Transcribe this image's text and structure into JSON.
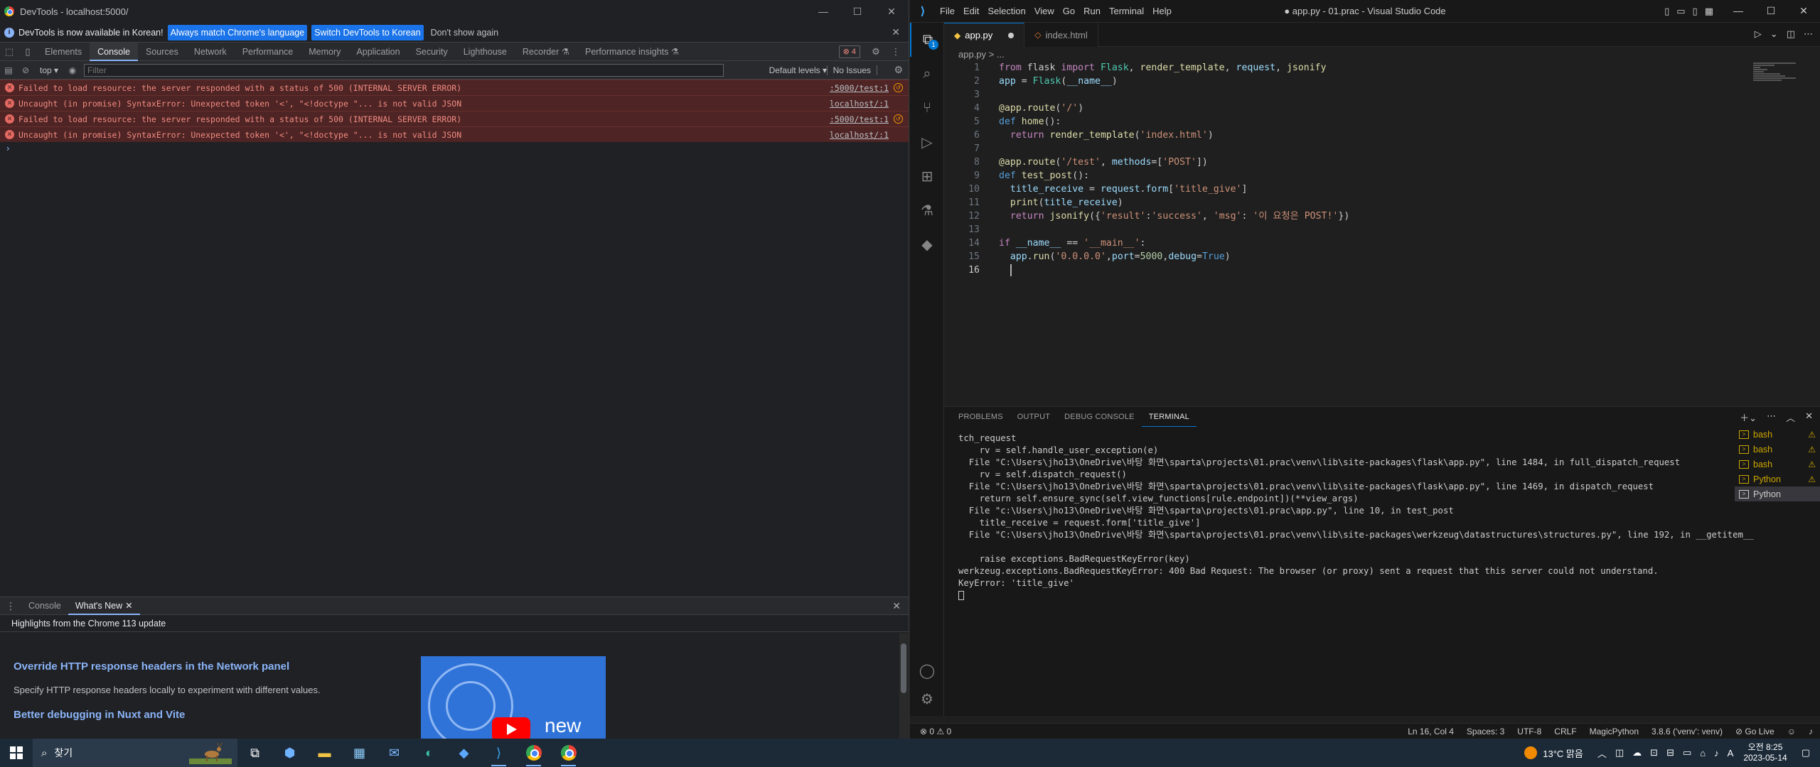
{
  "devtools": {
    "window_title": "DevTools - localhost:5000/",
    "infobar": {
      "message": "DevTools is now available in Korean!",
      "btn_match": "Always match Chrome's language",
      "btn_switch": "Switch DevTools to Korean",
      "btn_dismiss": "Don't show again"
    },
    "tabs": [
      "Elements",
      "Console",
      "Sources",
      "Network",
      "Performance",
      "Memory",
      "Application",
      "Security",
      "Lighthouse",
      "Recorder ⚗",
      "Performance insights ⚗"
    ],
    "error_badge": "4",
    "filter": {
      "context": "top",
      "placeholder": "Filter",
      "levels": "Default levels",
      "issues": "No Issues"
    },
    "logs": [
      {
        "msg": "Failed to load resource: the server responded with a status of 500 (INTERNAL SERVER ERROR)",
        "src": ":5000/test:1"
      },
      {
        "msg": "Uncaught (in promise) SyntaxError: Unexpected token '<', \"<!doctype \"... is not valid JSON",
        "src": "localhost/:1"
      },
      {
        "msg": "Failed to load resource: the server responded with a status of 500 (INTERNAL SERVER ERROR)",
        "src": ":5000/test:1"
      },
      {
        "msg": "Uncaught (in promise) SyntaxError: Unexpected token '<', \"<!doctype \"... is not valid JSON",
        "src": "localhost/:1"
      }
    ],
    "drawer": {
      "tab_console": "Console",
      "tab_whatsnew": "What's New",
      "highlights": "Highlights from the Chrome 113 update",
      "item1_title": "Override HTTP response headers in the Network panel",
      "item1_desc": "Specify HTTP response headers locally to experiment with different values.",
      "item2_title": "Better debugging in Nuxt and Vite",
      "img_text": "new"
    }
  },
  "vscode": {
    "menu": [
      "File",
      "Edit",
      "Selection",
      "View",
      "Go",
      "Run",
      "Terminal",
      "Help"
    ],
    "window_title": "● app.py - 01.prac - Visual Studio Code",
    "tabs": [
      {
        "label": "app.py"
      },
      {
        "label": "index.html"
      }
    ],
    "breadcrumb": "app.py > ...",
    "code": [
      [
        [
          "kw",
          "from"
        ],
        [
          "t",
          " flask "
        ],
        [
          "kw",
          "import"
        ],
        [
          "t",
          " "
        ],
        [
          "cls",
          "Flask"
        ],
        [
          "t",
          ", "
        ],
        [
          "fn",
          "render_template"
        ],
        [
          "t",
          ", "
        ],
        [
          "vr",
          "request"
        ],
        [
          "t",
          ", "
        ],
        [
          "fn",
          "jsonify"
        ]
      ],
      [
        [
          "vr",
          "app"
        ],
        [
          "t",
          " = "
        ],
        [
          "cls",
          "Flask"
        ],
        [
          "t",
          "("
        ],
        [
          "vr",
          "__name__"
        ],
        [
          "t",
          ")"
        ]
      ],
      [],
      [
        [
          "fn",
          "@app.route"
        ],
        [
          "t",
          "("
        ],
        [
          "st",
          "'/'"
        ],
        [
          "t",
          ")"
        ]
      ],
      [
        [
          "cn",
          "def"
        ],
        [
          "t",
          " "
        ],
        [
          "fn",
          "home"
        ],
        [
          "t",
          "():"
        ]
      ],
      [
        [
          "t",
          "  "
        ],
        [
          "kw",
          "return"
        ],
        [
          "t",
          " "
        ],
        [
          "fn",
          "render_template"
        ],
        [
          "t",
          "("
        ],
        [
          "st",
          "'index.html'"
        ],
        [
          "t",
          ")"
        ]
      ],
      [],
      [
        [
          "fn",
          "@app.route"
        ],
        [
          "t",
          "("
        ],
        [
          "st",
          "'/test'"
        ],
        [
          "t",
          ", "
        ],
        [
          "vr",
          "methods"
        ],
        [
          "t",
          "=["
        ],
        [
          "st",
          "'POST'"
        ],
        [
          "t",
          "])"
        ]
      ],
      [
        [
          "cn",
          "def"
        ],
        [
          "t",
          " "
        ],
        [
          "fn",
          "test_post"
        ],
        [
          "t",
          "():"
        ]
      ],
      [
        [
          "t",
          "  "
        ],
        [
          "vr",
          "title_receive"
        ],
        [
          "t",
          " = "
        ],
        [
          "vr",
          "request"
        ],
        [
          "t",
          "."
        ],
        [
          "vr",
          "form"
        ],
        [
          "t",
          "["
        ],
        [
          "st",
          "'title_give'"
        ],
        [
          "t",
          "]"
        ]
      ],
      [
        [
          "t",
          "  "
        ],
        [
          "fn",
          "print"
        ],
        [
          "t",
          "("
        ],
        [
          "vr",
          "title_receive"
        ],
        [
          "t",
          ")"
        ]
      ],
      [
        [
          "t",
          "  "
        ],
        [
          "kw",
          "return"
        ],
        [
          "t",
          " "
        ],
        [
          "fn",
          "jsonify"
        ],
        [
          "t",
          "({"
        ],
        [
          "st",
          "'result'"
        ],
        [
          "t",
          ":"
        ],
        [
          "st",
          "'success'"
        ],
        [
          "t",
          ", "
        ],
        [
          "st",
          "'msg'"
        ],
        [
          "t",
          ": "
        ],
        [
          "st",
          "'이 요청은 POST!'"
        ],
        [
          "t",
          "})"
        ]
      ],
      [],
      [
        [
          "kw",
          "if"
        ],
        [
          "t",
          " "
        ],
        [
          "vr",
          "__name__"
        ],
        [
          "t",
          " == "
        ],
        [
          "st",
          "'__main__'"
        ],
        [
          "t",
          ":"
        ]
      ],
      [
        [
          "t",
          "  "
        ],
        [
          "vr",
          "app"
        ],
        [
          "t",
          "."
        ],
        [
          "fn",
          "run"
        ],
        [
          "t",
          "("
        ],
        [
          "st",
          "'0.0.0.0'"
        ],
        [
          "t",
          ","
        ],
        [
          "vr",
          "port"
        ],
        [
          "t",
          "="
        ],
        [
          "nm",
          "5000"
        ],
        [
          "t",
          ","
        ],
        [
          "vr",
          "debug"
        ],
        [
          "t",
          "="
        ],
        [
          "cn",
          "True"
        ],
        [
          "t",
          ")"
        ]
      ],
      [
        [
          "t",
          "  "
        ]
      ]
    ],
    "panel_tabs": [
      "PROBLEMS",
      "OUTPUT",
      "DEBUG CONSOLE",
      "TERMINAL"
    ],
    "terminal": [
      "tch_request",
      "    rv = self.handle_user_exception(e)",
      "  File \"C:\\Users\\jho13\\OneDrive\\바탕 화면\\sparta\\projects\\01.prac\\venv\\lib\\site-packages\\flask\\app.py\", line 1484, in full_dispatch_request",
      "    rv = self.dispatch_request()",
      "  File \"C:\\Users\\jho13\\OneDrive\\바탕 화면\\sparta\\projects\\01.prac\\venv\\lib\\site-packages\\flask\\app.py\", line 1469, in dispatch_request",
      "    return self.ensure_sync(self.view_functions[rule.endpoint])(**view_args)",
      "  File \"c:\\Users\\jho13\\OneDrive\\바탕 화면\\sparta\\projects\\01.prac\\app.py\", line 10, in test_post",
      "    title_receive = request.form['title_give']",
      "  File \"C:\\Users\\jho13\\OneDrive\\바탕 화면\\sparta\\projects\\01.prac\\venv\\lib\\site-packages\\werkzeug\\datastructures\\structures.py\", line 192, in __getitem__",
      "",
      "    raise exceptions.BadRequestKeyError(key)",
      "werkzeug.exceptions.BadRequestKeyError: 400 Bad Request: The browser (or proxy) sent a request that this server could not understand.",
      "KeyError: 'title_give'"
    ],
    "terminals": [
      {
        "label": "bash",
        "warn": true
      },
      {
        "label": "bash",
        "warn": true
      },
      {
        "label": "bash",
        "warn": true
      },
      {
        "label": "Python",
        "warn": true
      },
      {
        "label": "Python",
        "warn": false
      }
    ],
    "status": {
      "problems": "⊗ 0 ⚠ 0",
      "cursor": "Ln 16, Col 4",
      "spaces": "Spaces: 3",
      "encoding": "UTF-8",
      "eol": "CRLF",
      "language": "MagicPython",
      "interpreter": "3.8.6 ('venv': venv)",
      "golive": "⊘ Go Live"
    }
  },
  "taskbar": {
    "search_placeholder": "찾기",
    "weather": "13°C 맑음",
    "time": "오전 8:25",
    "date": "2023-05-14",
    "ime": "A"
  }
}
